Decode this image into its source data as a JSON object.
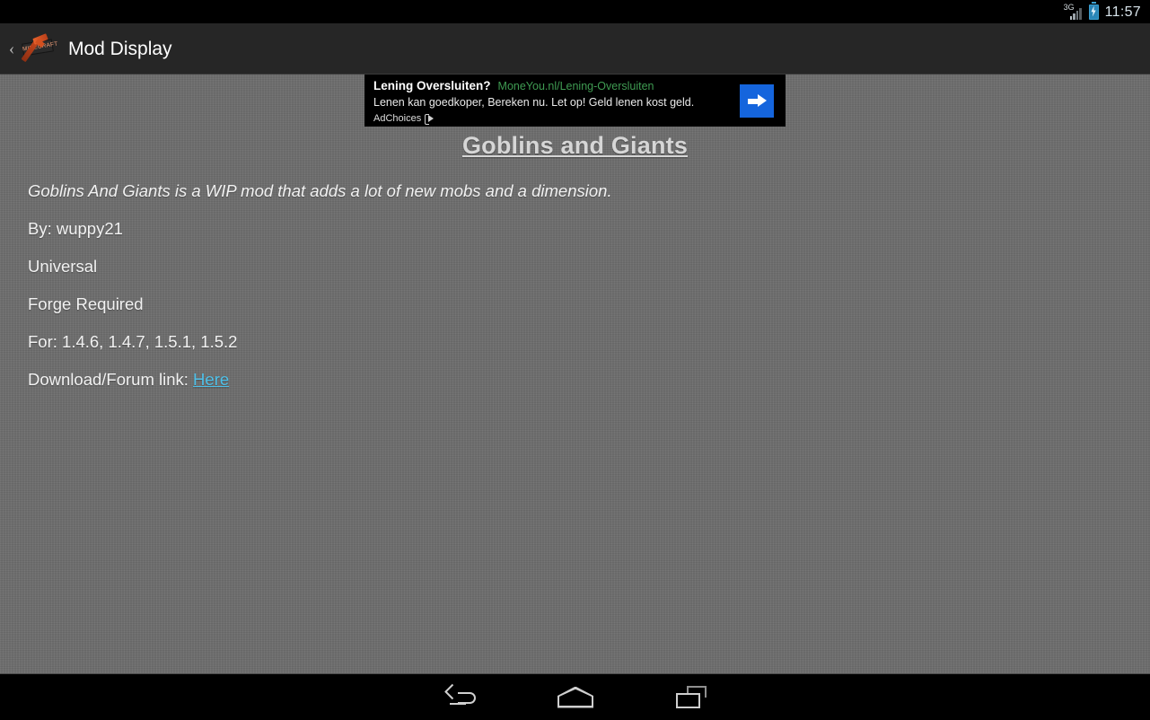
{
  "status_bar": {
    "network_label": "3G",
    "network_icon": "signal-bars-icon",
    "battery_icon": "battery-charging-icon",
    "time": "11:57"
  },
  "action_bar": {
    "up_chevron": "‹",
    "app_icon": "minecraft-pickaxe-icon",
    "app_icon_plate_text": "MINECRAFT",
    "title": "Mod Display"
  },
  "ad": {
    "headline": "Lening Oversluiten?",
    "url": "MoneYou.nl/Lening-Oversluiten",
    "body": "Lenen kan goedkoper, Bereken nu. Let op! Geld lenen kost geld.",
    "adchoices_label": "AdChoices",
    "adchoices_icon": "adchoices-triangle-icon",
    "arrow_icon": "arrow-right-icon",
    "arrow_color": "#1565dd",
    "url_color": "#3f9b52"
  },
  "mod": {
    "title": "Goblins and Giants",
    "description": "Goblins And Giants is a WIP mod that adds a lot of new mobs and a dimension.",
    "author": "By: wuppy21",
    "sides": "Universal",
    "forge": "Forge Required",
    "versions": "For: 1.4.6, 1.4.7, 1.5.1, 1.5.2",
    "download_label": "Download/Forum link:",
    "download_link": "Here",
    "link_color": "#4fc0e8"
  },
  "nav_bar": {
    "back_icon": "back-arrow-icon",
    "home_icon": "home-icon",
    "recents_icon": "recent-apps-icon"
  },
  "theme": {
    "content_background": "#6d6d6d",
    "action_bar_background": "#262626",
    "system_bar_background": "#000000",
    "text_color": "#f2f2f2"
  }
}
